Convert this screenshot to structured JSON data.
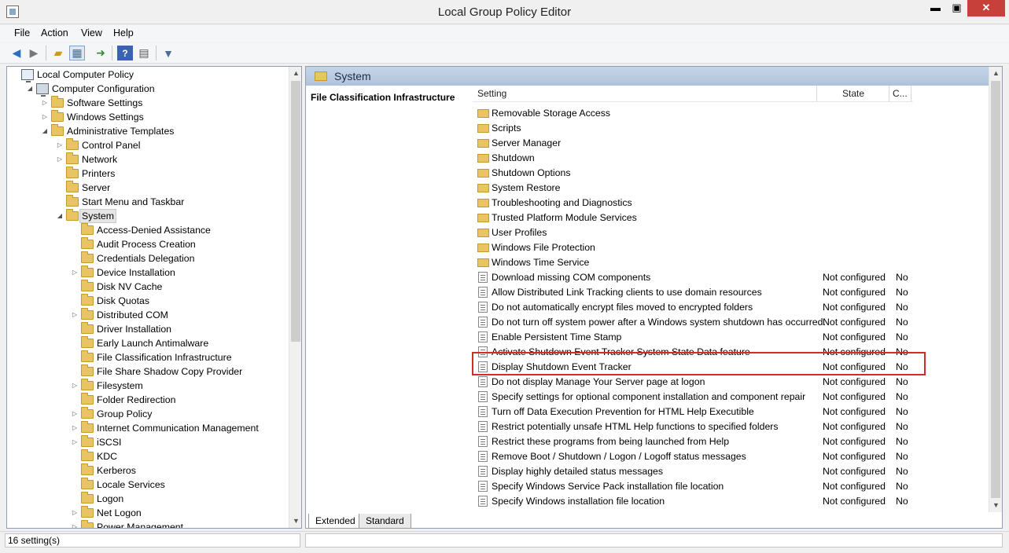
{
  "window": {
    "title": "Local Group Policy Editor",
    "min": "▬",
    "max": "▣",
    "close": "✕"
  },
  "menu": {
    "items": [
      "File",
      "Action",
      "View",
      "Help"
    ]
  },
  "toolbar": {
    "icons": [
      "back-icon",
      "forward-icon",
      "up-folder-icon",
      "show-hide-tree-icon",
      "export-list-icon",
      "help-icon",
      "properties-view-icon",
      "filter-icon"
    ]
  },
  "tree": [
    {
      "label": "Local Computer Policy",
      "indent": 0,
      "arrow": "",
      "icon": "policy"
    },
    {
      "label": "Computer Configuration",
      "indent": 1,
      "arrow": "◢",
      "icon": "pc"
    },
    {
      "label": "Software Settings",
      "indent": 2,
      "arrow": "▷",
      "icon": "folder"
    },
    {
      "label": "Windows Settings",
      "indent": 2,
      "arrow": "▷",
      "icon": "folder"
    },
    {
      "label": "Administrative Templates",
      "indent": 2,
      "arrow": "◢",
      "icon": "folder"
    },
    {
      "label": "Control Panel",
      "indent": 3,
      "arrow": "▷",
      "icon": "folder"
    },
    {
      "label": "Network",
      "indent": 3,
      "arrow": "▷",
      "icon": "folder"
    },
    {
      "label": "Printers",
      "indent": 3,
      "arrow": "",
      "icon": "folder"
    },
    {
      "label": "Server",
      "indent": 3,
      "arrow": "",
      "icon": "folder"
    },
    {
      "label": "Start Menu and Taskbar",
      "indent": 3,
      "arrow": "",
      "icon": "folder"
    },
    {
      "label": "System",
      "indent": 3,
      "arrow": "◢",
      "icon": "folder",
      "selected": true
    },
    {
      "label": "Access-Denied Assistance",
      "indent": 4,
      "arrow": "",
      "icon": "folder"
    },
    {
      "label": "Audit Process Creation",
      "indent": 4,
      "arrow": "",
      "icon": "folder"
    },
    {
      "label": "Credentials Delegation",
      "indent": 4,
      "arrow": "",
      "icon": "folder"
    },
    {
      "label": "Device Installation",
      "indent": 4,
      "arrow": "▷",
      "icon": "folder"
    },
    {
      "label": "Disk NV Cache",
      "indent": 4,
      "arrow": "",
      "icon": "folder"
    },
    {
      "label": "Disk Quotas",
      "indent": 4,
      "arrow": "",
      "icon": "folder"
    },
    {
      "label": "Distributed COM",
      "indent": 4,
      "arrow": "▷",
      "icon": "folder"
    },
    {
      "label": "Driver Installation",
      "indent": 4,
      "arrow": "",
      "icon": "folder"
    },
    {
      "label": "Early Launch Antimalware",
      "indent": 4,
      "arrow": "",
      "icon": "folder"
    },
    {
      "label": "File Classification Infrastructure",
      "indent": 4,
      "arrow": "",
      "icon": "folder"
    },
    {
      "label": "File Share Shadow Copy Provider",
      "indent": 4,
      "arrow": "",
      "icon": "folder"
    },
    {
      "label": "Filesystem",
      "indent": 4,
      "arrow": "▷",
      "icon": "folder"
    },
    {
      "label": "Folder Redirection",
      "indent": 4,
      "arrow": "",
      "icon": "folder"
    },
    {
      "label": "Group Policy",
      "indent": 4,
      "arrow": "▷",
      "icon": "folder"
    },
    {
      "label": "Internet Communication Management",
      "indent": 4,
      "arrow": "▷",
      "icon": "folder"
    },
    {
      "label": "iSCSI",
      "indent": 4,
      "arrow": "▷",
      "icon": "folder"
    },
    {
      "label": "KDC",
      "indent": 4,
      "arrow": "",
      "icon": "folder"
    },
    {
      "label": "Kerberos",
      "indent": 4,
      "arrow": "",
      "icon": "folder"
    },
    {
      "label": "Locale Services",
      "indent": 4,
      "arrow": "",
      "icon": "folder"
    },
    {
      "label": "Logon",
      "indent": 4,
      "arrow": "",
      "icon": "folder"
    },
    {
      "label": "Net Logon",
      "indent": 4,
      "arrow": "▷",
      "icon": "folder"
    },
    {
      "label": "Power Management",
      "indent": 4,
      "arrow": "▷",
      "icon": "folder"
    }
  ],
  "right": {
    "header_title": "System",
    "description_title": "File Classification Infrastructure",
    "columns": {
      "setting": "Setting",
      "state": "State",
      "comment": "C..."
    },
    "rows": [
      {
        "type": "folder",
        "name": "Removable Storage Access",
        "state": "",
        "comment": ""
      },
      {
        "type": "folder",
        "name": "Scripts",
        "state": "",
        "comment": ""
      },
      {
        "type": "folder",
        "name": "Server Manager",
        "state": "",
        "comment": ""
      },
      {
        "type": "folder",
        "name": "Shutdown",
        "state": "",
        "comment": ""
      },
      {
        "type": "folder",
        "name": "Shutdown Options",
        "state": "",
        "comment": ""
      },
      {
        "type": "folder",
        "name": "System Restore",
        "state": "",
        "comment": ""
      },
      {
        "type": "folder",
        "name": "Troubleshooting and Diagnostics",
        "state": "",
        "comment": ""
      },
      {
        "type": "folder",
        "name": "Trusted Platform Module Services",
        "state": "",
        "comment": ""
      },
      {
        "type": "folder",
        "name": "User Profiles",
        "state": "",
        "comment": ""
      },
      {
        "type": "folder",
        "name": "Windows File Protection",
        "state": "",
        "comment": ""
      },
      {
        "type": "folder",
        "name": "Windows Time Service",
        "state": "",
        "comment": ""
      },
      {
        "type": "policy",
        "name": "Download missing COM components",
        "state": "Not configured",
        "comment": "No"
      },
      {
        "type": "policy",
        "name": "Allow Distributed Link Tracking clients to use domain resources",
        "state": "Not configured",
        "comment": "No"
      },
      {
        "type": "policy",
        "name": "Do not automatically encrypt files moved to encrypted folders",
        "state": "Not configured",
        "comment": "No"
      },
      {
        "type": "policy",
        "name": "Do not turn off system power after a Windows system shutdown has occurred.",
        "state": "Not configured",
        "comment": "No"
      },
      {
        "type": "policy",
        "name": "Enable Persistent Time Stamp",
        "state": "Not configured",
        "comment": "No"
      },
      {
        "type": "policy",
        "name": "Activate Shutdown Event Tracker System State Data feature",
        "state": "Not configured",
        "comment": "No"
      },
      {
        "type": "policy",
        "name": "Display Shutdown Event Tracker",
        "state": "Not configured",
        "comment": "No",
        "highlighted": true
      },
      {
        "type": "policy",
        "name": "Do not display Manage Your Server page at logon",
        "state": "Not configured",
        "comment": "No"
      },
      {
        "type": "policy",
        "name": "Specify settings for optional component installation and component repair",
        "state": "Not configured",
        "comment": "No"
      },
      {
        "type": "policy",
        "name": "Turn off Data Execution Prevention for HTML Help Executible",
        "state": "Not configured",
        "comment": "No"
      },
      {
        "type": "policy",
        "name": "Restrict potentially unsafe HTML Help functions to specified folders",
        "state": "Not configured",
        "comment": "No"
      },
      {
        "type": "policy",
        "name": "Restrict these programs from being launched from Help",
        "state": "Not configured",
        "comment": "No"
      },
      {
        "type": "policy",
        "name": "Remove Boot / Shutdown / Logon / Logoff status messages",
        "state": "Not configured",
        "comment": "No"
      },
      {
        "type": "policy",
        "name": "Display highly detailed status messages",
        "state": "Not configured",
        "comment": "No"
      },
      {
        "type": "policy",
        "name": "Specify Windows Service Pack installation file location",
        "state": "Not configured",
        "comment": "No"
      },
      {
        "type": "policy",
        "name": "Specify Windows installation file location",
        "state": "Not configured",
        "comment": "No"
      }
    ]
  },
  "tabs": [
    "Extended",
    "Standard"
  ],
  "status": {
    "text": "16 setting(s)"
  },
  "colors": {
    "highlight_box": "#d42a2a",
    "header_gradient_top": "#c5d5e8",
    "close_button": "#c7403a"
  }
}
